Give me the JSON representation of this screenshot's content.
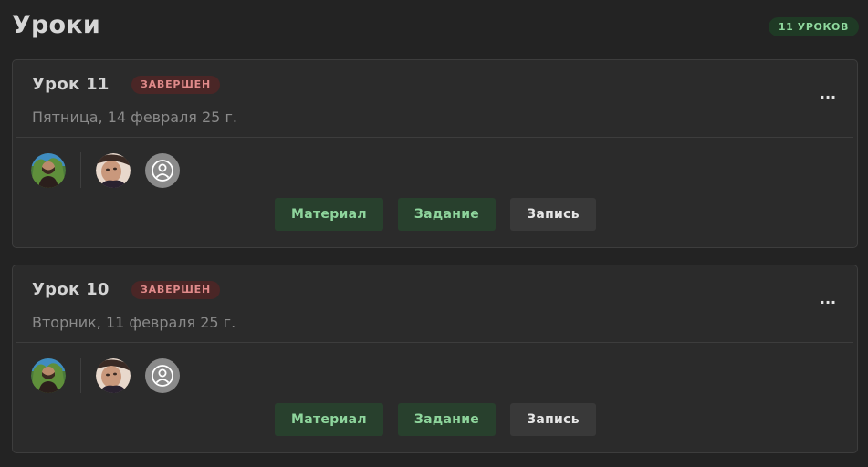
{
  "header": {
    "title": "Уроки",
    "count_badge": "11 УРОКОВ"
  },
  "colors": {
    "background": "#232323",
    "card": "#2b2b2b",
    "green_accent": "#8ed59c",
    "green_bg": "#28402d",
    "red_accent": "#e08a8a",
    "red_bg": "#4a2626"
  },
  "lessons": [
    {
      "title": "Урок 11",
      "status": "ЗАВЕРШЕН",
      "date": "Пятница, 14 февраля 25 г.",
      "more_label": "...",
      "buttons": {
        "material": "Материал",
        "task": "Задание",
        "record": "Запись"
      },
      "avatars": [
        "teacher-photo",
        "student-photo",
        "user-placeholder-icon"
      ]
    },
    {
      "title": "Урок 10",
      "status": "ЗАВЕРШЕН",
      "date": "Вторник, 11 февраля 25 г.",
      "more_label": "...",
      "buttons": {
        "material": "Материал",
        "task": "Задание",
        "record": "Запись"
      },
      "avatars": [
        "teacher-photo",
        "student-photo",
        "user-placeholder-icon"
      ]
    }
  ]
}
